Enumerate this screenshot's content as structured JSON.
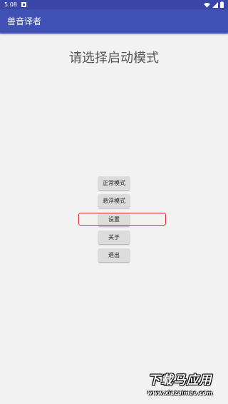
{
  "status_bar": {
    "time": "5:08"
  },
  "app_bar": {
    "title": "兽音译者"
  },
  "main": {
    "prompt": "请选择启动模式",
    "buttons": [
      {
        "label": "正常模式"
      },
      {
        "label": "悬浮模式"
      },
      {
        "label": "设置"
      },
      {
        "label": "关于"
      },
      {
        "label": "退出"
      }
    ]
  },
  "watermark": {
    "main": "下载马应用",
    "url": "www.xiazaimao.com"
  },
  "colors": {
    "app_bar": "#3f51b5",
    "status_bar": "#3a47a8",
    "background": "#f2f2f2",
    "button": "#dcdcdc",
    "highlight": "#e03030"
  },
  "icons": [
    "notification-icon",
    "wifi-icon",
    "signal-icon",
    "battery-icon"
  ]
}
